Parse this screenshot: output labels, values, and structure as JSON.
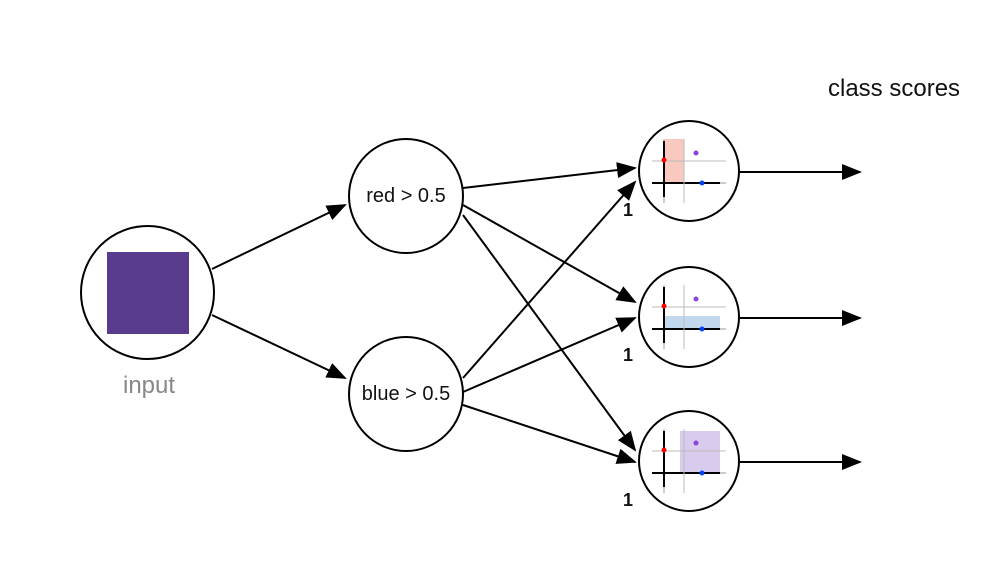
{
  "title": "class scores",
  "input_label": "input",
  "hidden_nodes": [
    {
      "label": "red > 0.5"
    },
    {
      "label": "blue > 0.5"
    }
  ],
  "output_nodes": [
    {
      "bias": "1",
      "region": "red"
    },
    {
      "bias": "1",
      "region": "blue"
    },
    {
      "bias": "1",
      "region": "purple"
    }
  ],
  "colors": {
    "purple_square": "#5a3c8f",
    "red_fill": "#f6b2a5",
    "blue_fill": "#a8c8e8",
    "purple_fill": "#c9b5e6",
    "red_dot": "#ff0000",
    "blue_dot": "#0044ff",
    "purple_dot": "#8844dd",
    "axis_gray": "#999999"
  }
}
